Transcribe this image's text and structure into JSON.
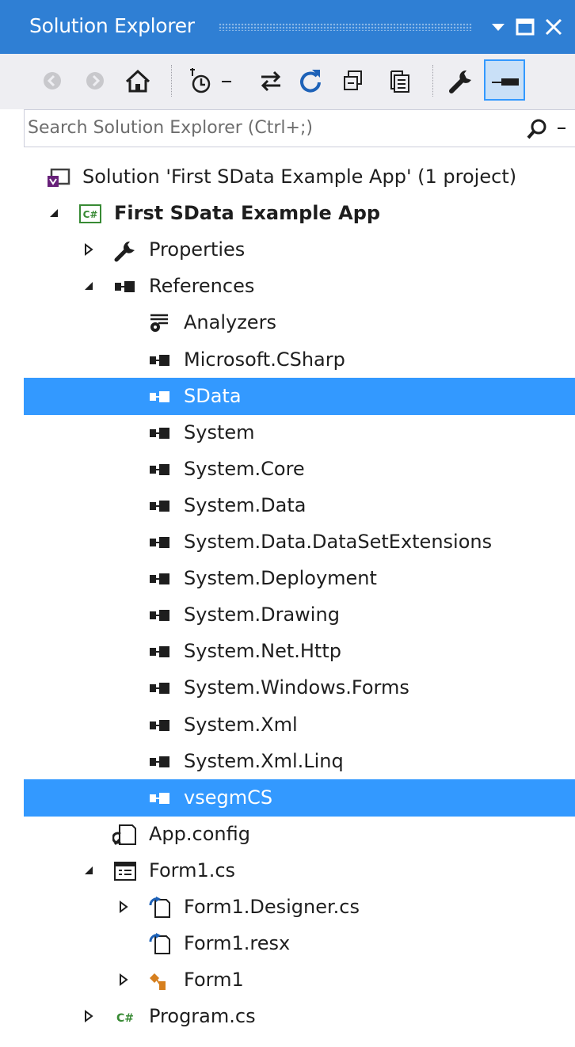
{
  "window": {
    "title": "Solution Explorer"
  },
  "toolbar": {
    "items": [
      "back-icon",
      "forward-icon",
      "home-icon",
      "pending-changes-filter-icon",
      "sync-with-active-document-icon",
      "refresh-icon",
      "collapse-all-icon",
      "show-all-files-icon",
      "properties-icon",
      "preview-selected-items-icon"
    ]
  },
  "search": {
    "placeholder": "Search Solution Explorer (Ctrl+;)",
    "value": ""
  },
  "colors": {
    "accent": "#2f7fd4",
    "selection": "#3399ff",
    "toolbar_bg": "#eeeef2"
  },
  "tree": [
    {
      "label": "Solution 'First SData Example App' (1 project)",
      "icon": "solution-icon",
      "expander": "none",
      "selected": false,
      "bold": false
    },
    {
      "label": "First SData Example App",
      "icon": "csharp-project-icon",
      "expander": "expanded",
      "selected": false,
      "bold": true
    },
    {
      "label": "Properties",
      "icon": "wrench-icon",
      "expander": "collapsed",
      "selected": false,
      "bold": false
    },
    {
      "label": "References",
      "icon": "references-icon",
      "expander": "expanded",
      "selected": false,
      "bold": false
    },
    {
      "label": "Analyzers",
      "icon": "analyzers-icon",
      "expander": "none",
      "selected": false,
      "bold": false
    },
    {
      "label": "Microsoft.CSharp",
      "icon": "reference-icon",
      "expander": "none",
      "selected": false,
      "bold": false
    },
    {
      "label": "SData",
      "icon": "reference-icon",
      "expander": "none",
      "selected": true,
      "bold": false
    },
    {
      "label": "System",
      "icon": "reference-icon",
      "expander": "none",
      "selected": false,
      "bold": false
    },
    {
      "label": "System.Core",
      "icon": "reference-icon",
      "expander": "none",
      "selected": false,
      "bold": false
    },
    {
      "label": "System.Data",
      "icon": "reference-icon",
      "expander": "none",
      "selected": false,
      "bold": false
    },
    {
      "label": "System.Data.DataSetExtensions",
      "icon": "reference-icon",
      "expander": "none",
      "selected": false,
      "bold": false
    },
    {
      "label": "System.Deployment",
      "icon": "reference-icon",
      "expander": "none",
      "selected": false,
      "bold": false
    },
    {
      "label": "System.Drawing",
      "icon": "reference-icon",
      "expander": "none",
      "selected": false,
      "bold": false
    },
    {
      "label": "System.Net.Http",
      "icon": "reference-icon",
      "expander": "none",
      "selected": false,
      "bold": false
    },
    {
      "label": "System.Windows.Forms",
      "icon": "reference-icon",
      "expander": "none",
      "selected": false,
      "bold": false
    },
    {
      "label": "System.Xml",
      "icon": "reference-icon",
      "expander": "none",
      "selected": false,
      "bold": false
    },
    {
      "label": "System.Xml.Linq",
      "icon": "reference-icon",
      "expander": "none",
      "selected": false,
      "bold": false
    },
    {
      "label": "vsegmCS",
      "icon": "reference-icon",
      "expander": "none",
      "selected": true,
      "bold": false
    },
    {
      "label": "App.config",
      "icon": "config-file-icon",
      "expander": "none",
      "selected": false,
      "bold": false
    },
    {
      "label": "Form1.cs",
      "icon": "form-icon",
      "expander": "expanded",
      "selected": false,
      "bold": false
    },
    {
      "label": "Form1.Designer.cs",
      "icon": "generated-file-icon",
      "expander": "collapsed",
      "selected": false,
      "bold": false
    },
    {
      "label": "Form1.resx",
      "icon": "generated-file-icon",
      "expander": "none",
      "selected": false,
      "bold": false
    },
    {
      "label": "Form1",
      "icon": "class-icon",
      "expander": "collapsed",
      "selected": false,
      "bold": false
    },
    {
      "label": "Program.cs",
      "icon": "csharp-file-icon",
      "expander": "collapsed",
      "selected": false,
      "bold": false
    }
  ]
}
